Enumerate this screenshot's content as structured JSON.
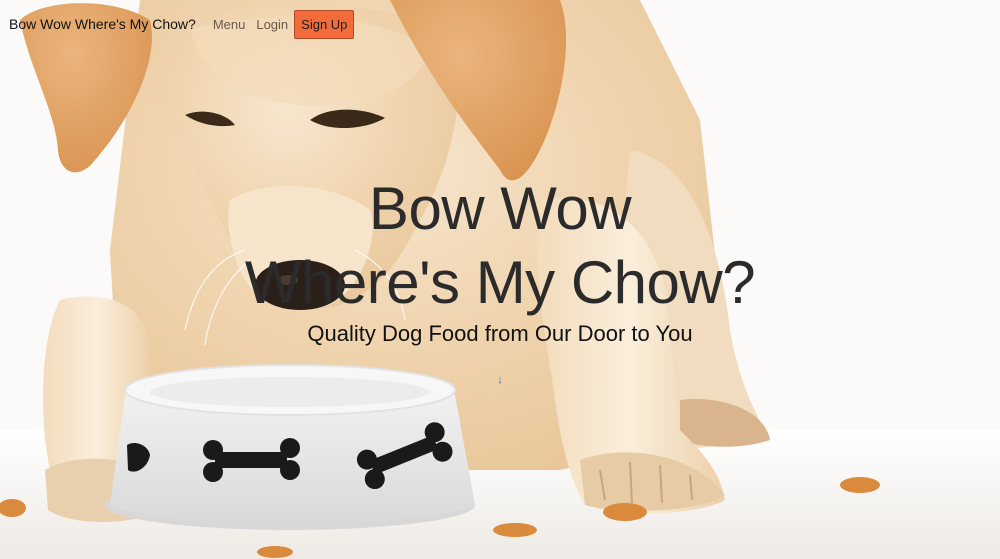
{
  "navbar": {
    "brand": "Bow Wow Where's My Chow?",
    "links": [
      "Menu",
      "Login"
    ],
    "signup_label": "Sign Up"
  },
  "hero": {
    "title_line1": "Bow Wow",
    "title_line2": "Where's My Chow?",
    "tagline": "Quality Dog Food from Our Door to You",
    "scroll_arrow": "↓"
  },
  "colors": {
    "signup_bg": "#f36b3a",
    "title_text": "#2b2b2b",
    "nav_link": "#6a5a4a"
  },
  "icons": {
    "scroll": "arrow-down-icon"
  }
}
